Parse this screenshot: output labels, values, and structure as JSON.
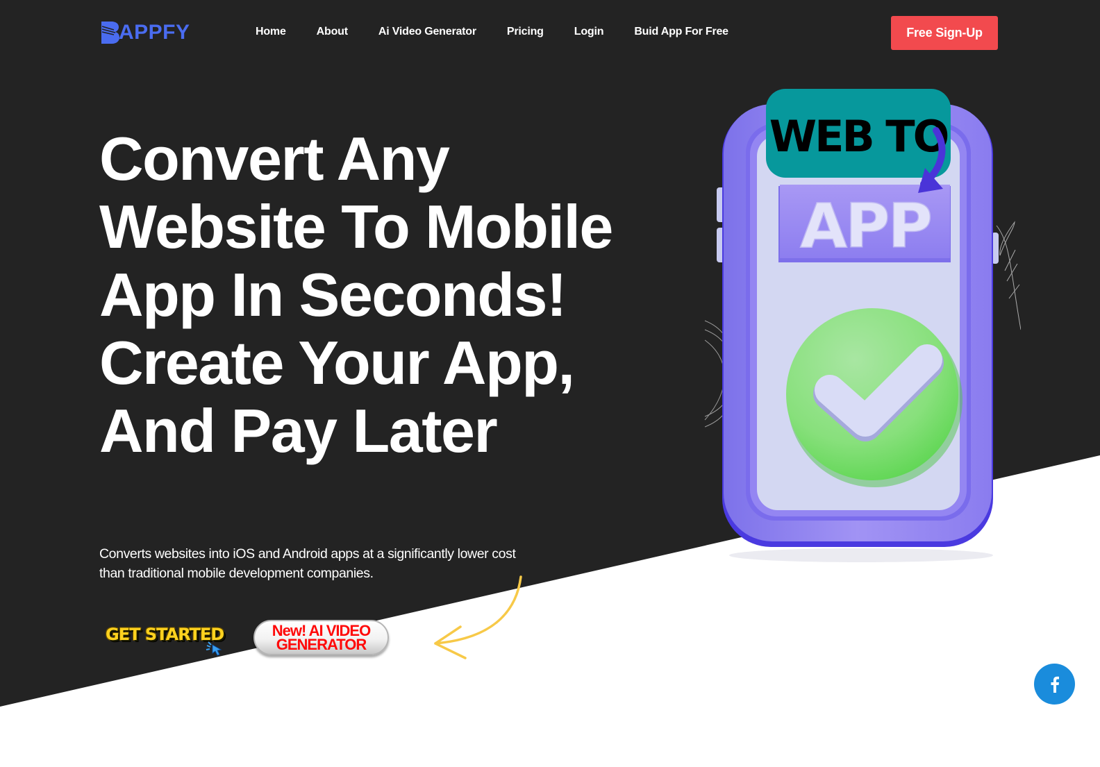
{
  "brand": {
    "name": "APPFY",
    "logo_letter": "B",
    "logo_color": "#4a6cf0"
  },
  "nav": {
    "items": [
      {
        "label": "Home"
      },
      {
        "label": "About"
      },
      {
        "label": "Ai Video Generator"
      },
      {
        "label": "Pricing"
      },
      {
        "label": "Login"
      },
      {
        "label": "Buid App For Free"
      }
    ],
    "cta_label": "Free Sign-Up",
    "cta_color": "#f24a4e"
  },
  "hero": {
    "headline": "Convert Any Website To Mobile App In Seconds! Create Your App, And Pay Later",
    "subtext": "Converts websites into iOS and Android apps at a significantly lower cost than traditional mobile development companies.",
    "get_started_label": "GET STARTED",
    "ai_video_line1": "New! AI VIDEO",
    "ai_video_line2": "GENERATOR",
    "background_color": "#232323"
  },
  "illustration": {
    "banner_text": "WEB TO",
    "app_text": "APP",
    "icon": "check-circle-icon",
    "colors": {
      "phone": "#9a8af0",
      "screen": "#d4d8f2",
      "banner": "#07989c",
      "check": "#7ee07a"
    }
  },
  "social": {
    "facebook_icon": "facebook-icon",
    "facebook_color": "#1a8cdc",
    "facebook_glyph": "f"
  }
}
